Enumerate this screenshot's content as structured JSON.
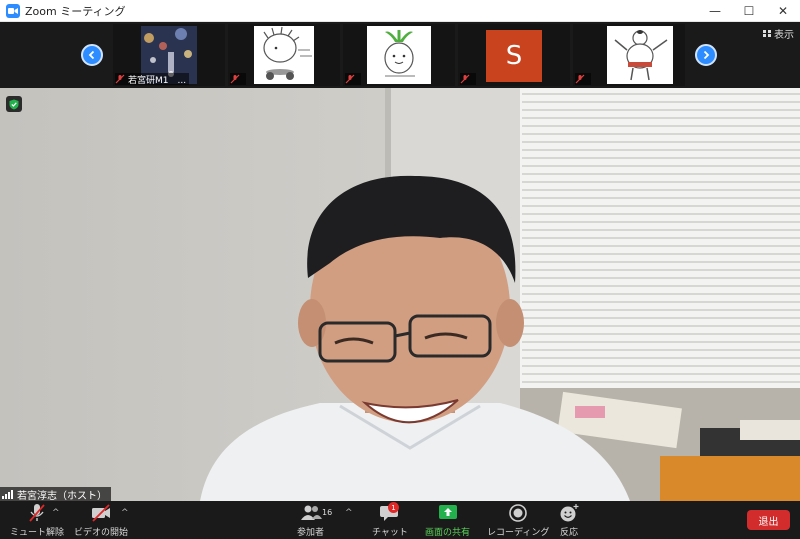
{
  "window": {
    "title": "Zoom ミーティング",
    "minimize": "—",
    "maximize": "☐",
    "close": "✕"
  },
  "filmstrip": {
    "prev_icon": "chevron-left-icon",
    "next_icon": "chevron-right-icon",
    "view_label": "表示",
    "tiles": [
      {
        "name": "若宮研M1　..."
      },
      {
        "name": ""
      },
      {
        "name": ""
      },
      {
        "name": "",
        "avatar_letter": "S",
        "avatar_color": "#c8431e"
      },
      {
        "name": ""
      }
    ]
  },
  "main": {
    "speaker_name": "若宮淳志（ホスト）"
  },
  "toolbar": {
    "unmute_label": "ミュート解除",
    "video_label": "ビデオの開始",
    "participants_label": "参加者",
    "participants_count": "16",
    "chat_label": "チャット",
    "chat_badge": "1",
    "share_label": "画面の共有",
    "record_label": "レコーディング",
    "reactions_label": "反応",
    "leave_label": "退出",
    "caret": "^"
  },
  "colors": {
    "accent": "#2d8cff",
    "share_green": "#22b14c",
    "leave_red": "#d22c2c"
  }
}
